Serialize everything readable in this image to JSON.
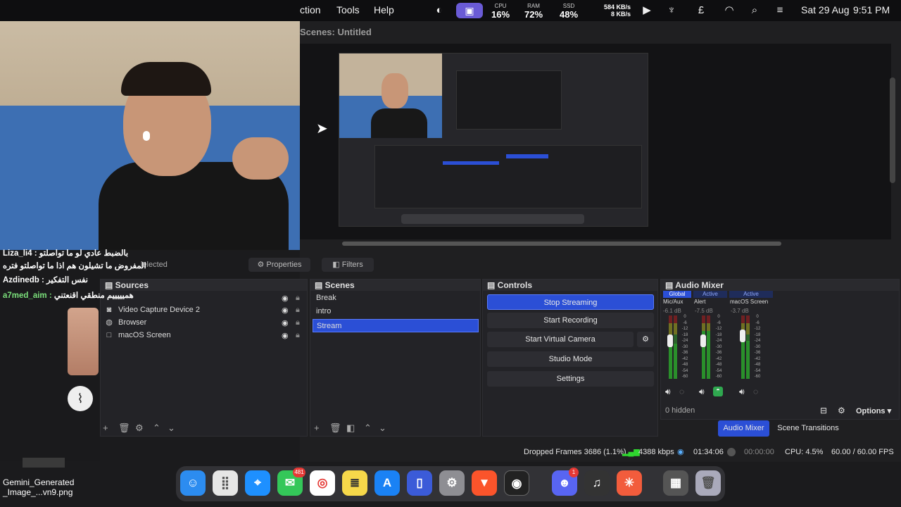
{
  "menubar": {
    "partial_menu": "ction",
    "tools": "Tools",
    "help": "Help",
    "cpu_label": "CPU",
    "cpu_val": "16%",
    "ram_label": "RAM",
    "ram_val": "72%",
    "ssd_label": "SSD",
    "ssd_val": "48%",
    "net_up": "584 KB/s",
    "net_down": "8 KB/s",
    "date": "Sat 29 Aug",
    "time": "9:51 PM"
  },
  "obs": {
    "scene_title": "Scenes: Untitled",
    "properties_label": "Properties",
    "filters_label": "Filters",
    "selected_partial": "lelected",
    "sources": {
      "title": "Sources",
      "items": [
        {
          "label": "Video Capture Device 2",
          "icon": "camera-icon"
        },
        {
          "label": "Browser",
          "icon": "globe-icon"
        },
        {
          "label": "macOS Screen",
          "icon": "display-icon"
        }
      ]
    },
    "scenes": {
      "title": "Scenes",
      "items": [
        "Break",
        "intro",
        "Stream"
      ],
      "selected": "Stream"
    },
    "controls": {
      "title": "Controls",
      "stop_streaming": "Stop Streaming",
      "start_recording": "Start Recording",
      "start_virtual_camera": "Start Virtual Camera",
      "studio_mode": "Studio Mode",
      "settings": "Settings"
    },
    "mixer": {
      "title": "Audio Mixer",
      "global": "Global",
      "active1": "Active",
      "active2": "Active",
      "channels": [
        {
          "name": "Mic/Aux",
          "db": "-6.1 dB",
          "level": 0.55,
          "fader": 0.62
        },
        {
          "name": "Alert",
          "db": "-7.5 dB",
          "level": 0.75,
          "fader": 0.62
        },
        {
          "name": "macOS Screen",
          "db": "-3.7 dB",
          "level": 0.6,
          "fader": 0.72
        }
      ],
      "scale": [
        "0",
        "-6",
        "-12",
        "-18",
        "-24",
        "-30",
        "-36",
        "-42",
        "-48",
        "-54",
        "-60"
      ],
      "hidden": "0 hidden",
      "options": "Options"
    },
    "tabs": {
      "audio_mixer": "Audio Mixer",
      "scene_transitions": "Scene Transitions"
    },
    "status": {
      "dropped": "Dropped Frames 3686 (1.1%)",
      "kbps": "4388 kbps",
      "live_time": "01:34:06",
      "rec_time": "00:00:00",
      "cpu": "CPU: 4.5%",
      "fps": "60.00 / 60.00 FPS"
    }
  },
  "chat": {
    "lines": [
      {
        "user": "Liza_li4 :",
        "msg": "بالضبط عادي لو ما تواصلتو"
      },
      {
        "user": "",
        "msg": "المفروض ما تشيلون هم اذا ما تواصلتو فتره"
      },
      {
        "user": "Azdinedb :",
        "msg": "نفس التفكير"
      },
      {
        "user": "a7med_aim :",
        "msg": "هميييييم منطقي اقنعتني"
      }
    ]
  },
  "dock": {
    "messages_badge": "481",
    "discord_badge": "1"
  },
  "desktop": {
    "file_label_1": "Gemini_Generated",
    "file_label_2": "_Image_...vn9.png"
  },
  "colors": {
    "accent": "#2b4fd6",
    "menubar": "#0e0e10",
    "panel": "#232327"
  }
}
